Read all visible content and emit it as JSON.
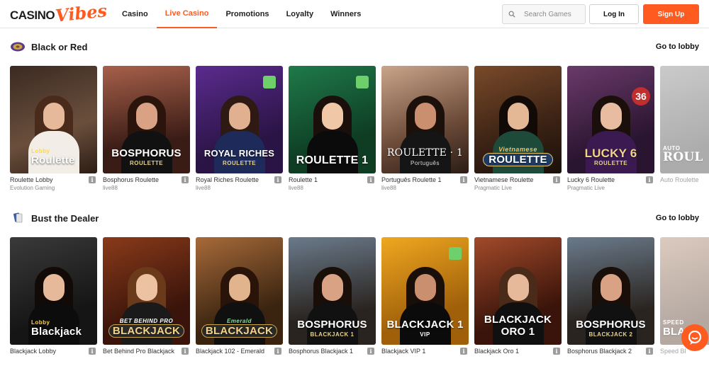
{
  "header": {
    "logo_casino": "CASINO",
    "logo_vibes": "Vibes",
    "nav": [
      {
        "label": "Casino"
      },
      {
        "label": "Live Casino"
      },
      {
        "label": "Promotions"
      },
      {
        "label": "Loyalty"
      },
      {
        "label": "Winners"
      }
    ],
    "search_placeholder": "Search Games",
    "login_label": "Log In",
    "signup_label": "Sign Up"
  },
  "colors": {
    "accent": "#ff5a1f"
  },
  "sections": [
    {
      "title": "Black or Red",
      "icon": "roulette-wheel-icon",
      "goto_label": "Go to lobby",
      "cards": [
        {
          "name": "Roulette Lobby",
          "provider": "Evolution Gaming",
          "banner_small": "Lobby",
          "banner_big": "Roulette"
        },
        {
          "name": "Bosphorus Roulette",
          "provider": "live88",
          "banner_big": "BOSPHORUS",
          "banner_small": "ROULETTE"
        },
        {
          "name": "Royal Riches Roulette",
          "provider": "live88",
          "banner_big": "ROYAL RICHES",
          "banner_small": "ROULETTE"
        },
        {
          "name": "Roulette 1",
          "provider": "live88",
          "banner_big": "ROULETTE 1"
        },
        {
          "name": "Português Roulette 1",
          "provider": "live88",
          "banner_big": "ROULETTE · 1",
          "banner_small": "Português"
        },
        {
          "name": "Vietnamese Roulette",
          "provider": "Pragmatic Live",
          "banner_small": "Vietnamese",
          "banner_big": "ROULETTE"
        },
        {
          "name": "Lucky 6 Roulette",
          "provider": "Pragmatic Live",
          "banner_big": "LUCKY 6",
          "banner_small": "ROULETTE",
          "corner_number": "36"
        },
        {
          "name": "Auto Roulette",
          "provider": "",
          "banner_small": "AUTO",
          "banner_big": "ROUL"
        }
      ]
    },
    {
      "title": "Bust the Dealer",
      "icon": "playing-cards-icon",
      "goto_label": "Go to lobby",
      "cards": [
        {
          "name": "Blackjack Lobby",
          "provider": "",
          "banner_small": "Lobby",
          "banner_big": "Blackjack"
        },
        {
          "name": "Bet Behind Pro Blackjack",
          "provider": "",
          "banner_small": "BET BEHIND PRO",
          "banner_big": "BLACKJACK"
        },
        {
          "name": "Blackjack 102 - Emerald",
          "provider": "",
          "banner_small": "Emerald",
          "banner_big": "BLACKJACK"
        },
        {
          "name": "Bosphorus Blackjack 1",
          "provider": "",
          "banner_big": "BOSPHORUS",
          "banner_small": "BLACKJACK 1"
        },
        {
          "name": "Blackjack VIP 1",
          "provider": "",
          "banner_big": "BLACKJACK 1",
          "banner_small": "VIP"
        },
        {
          "name": "Blackjack Oro 1",
          "provider": "",
          "banner_big": "BLACKJACK",
          "banner_small": "ORO 1"
        },
        {
          "name": "Bosphorus Blackjack 2",
          "provider": "",
          "banner_big": "BOSPHORUS",
          "banner_small": "BLACKJACK 2"
        },
        {
          "name": "Speed Bl",
          "provider": "",
          "banner_small": "SPEED",
          "banner_big": "BLA"
        }
      ]
    }
  ]
}
